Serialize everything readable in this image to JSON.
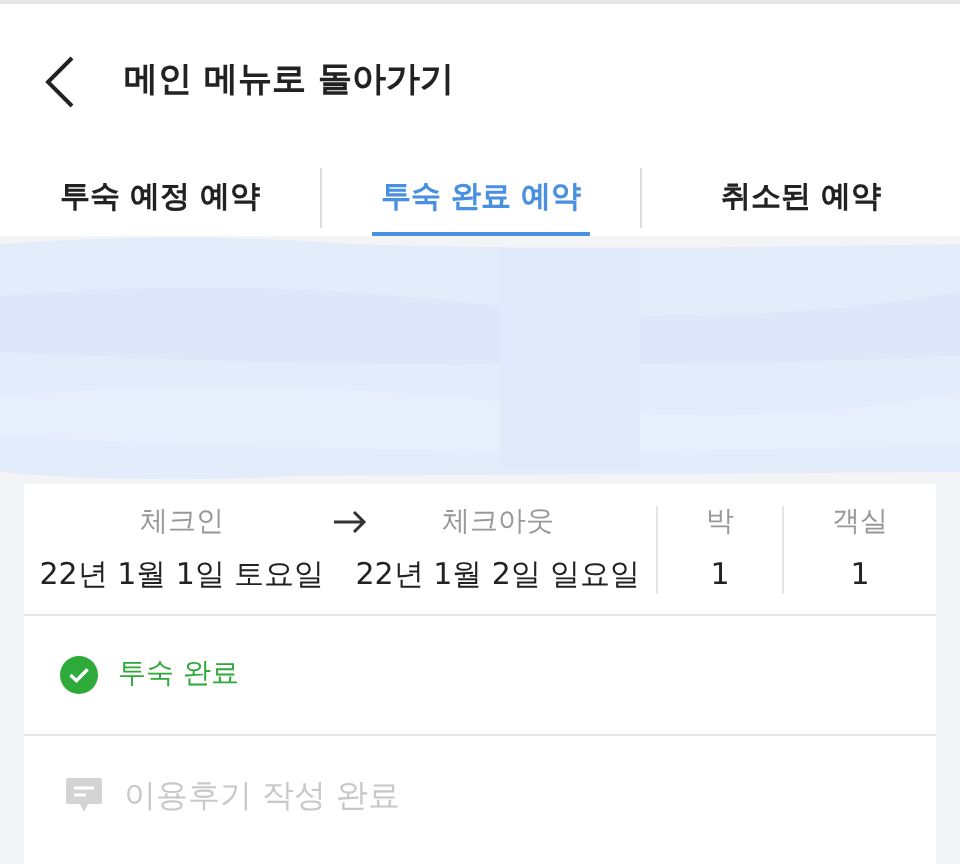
{
  "header": {
    "title": "메인 메뉴로 돌아가기"
  },
  "tabs": [
    {
      "label": "투숙 예정 예약",
      "selected": false
    },
    {
      "label": "투숙 완료 예약",
      "selected": true
    },
    {
      "label": "취소된 예약",
      "selected": false
    }
  ],
  "stay": {
    "checkin_label": "체크인",
    "checkin_date": "22년 1월 1일 토요일",
    "checkout_label": "체크아웃",
    "checkout_date": "22년 1월 2일 일요일",
    "nights_label": "박",
    "nights": "1",
    "rooms_label": "객실",
    "rooms": "1"
  },
  "status": {
    "label": "투숙 완료",
    "done": true
  },
  "review": {
    "label": "이용후기 작성 완료",
    "disabled": true
  }
}
